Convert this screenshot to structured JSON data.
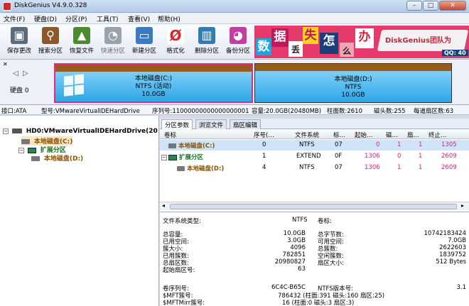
{
  "window": {
    "title": "DiskGenius V4.9.0.328",
    "min": "–",
    "max": "□",
    "close": "✕"
  },
  "menu": [
    "文件(F)",
    "硬盘(D)",
    "分区(P)",
    "工具(T)",
    "查看(V)",
    "帮助(H)"
  ],
  "toolbar": [
    {
      "label": "保存更改",
      "icon": "save-icon",
      "color": "#5d6b7e",
      "glyph": "▣"
    },
    {
      "label": "搜索分区",
      "icon": "search-icon",
      "color": "#8a5a2b",
      "glyph": "⚲"
    },
    {
      "label": "恢复文件",
      "icon": "recover-icon",
      "color": "#4d8a2f",
      "glyph": "▲"
    },
    {
      "label": "快速分区",
      "icon": "quick-partition-icon",
      "color": "#9aa3ad",
      "glyph": "◔"
    },
    {
      "label": "新建分区",
      "icon": "new-partition-icon",
      "color": "#3b7bbf",
      "glyph": "▭"
    },
    {
      "label": "格式化",
      "icon": "format-icon",
      "color": "#d22a2a",
      "glyph": "Ø"
    },
    {
      "label": "删除分区",
      "icon": "delete-partition-icon",
      "color": "#2f7db3",
      "glyph": "▥"
    },
    {
      "label": "备份分区",
      "icon": "backup-partition-icon",
      "color": "#c03fa0",
      "glyph": "◕"
    }
  ],
  "banner": {
    "chars": [
      "数",
      "据",
      "丢",
      "失",
      "怎",
      "么",
      "办"
    ],
    "brand": "DiskGenius团队为",
    "qq": "QQ: 40"
  },
  "diskpanel": {
    "nav_left": "◁",
    "nav_right": "▷",
    "label": "硬盘 0",
    "partitions": [
      {
        "name": "本地磁盘(C:)",
        "fs": "NTFS (活动)",
        "size": "10.0GB"
      },
      {
        "name": "本地磁盘(D:)",
        "fs": "NTFS",
        "size": "10.0GB"
      }
    ]
  },
  "infobar": {
    "iface": "接口:ATA",
    "model": "型号:VMwareVirtualIDEHardDrive",
    "serial": "序列号:11000000000000000001",
    "capacity": "容量:20.0GB(20480MB)",
    "cylinders": "柱面数:2610",
    "heads": "磁头数:255",
    "sectors": "每道扇区数:63"
  },
  "tree": {
    "disk": "HD0:VMwareVirtualIDEHardDrive(20",
    "c": "本地磁盘(C:)",
    "ext": "扩展分区",
    "d": "本地磁盘(D:)"
  },
  "tabs": [
    "分区参数",
    "浏览文件",
    "扇区编辑"
  ],
  "ptable": {
    "headers": [
      "卷标",
      "序号(…",
      "文件系统",
      "标…",
      "起始…",
      "磁…",
      "扇…",
      "终止…"
    ],
    "rows": [
      {
        "label": "本地磁盘(C:)",
        "num": "0",
        "fs": "NTFS",
        "id": "07",
        "start": "0",
        "head": "1",
        "sec": "1",
        "end": "1305"
      },
      {
        "label": "扩展分区",
        "num": "1",
        "fs": "EXTEND",
        "id": "0F",
        "start": "1306",
        "head": "0",
        "sec": "1",
        "end": "2609"
      },
      {
        "label": "本地磁盘(D:)",
        "num": "4",
        "fs": "NTFS",
        "id": "07",
        "start": "1306",
        "head": "1",
        "sec": "1",
        "end": "2609"
      }
    ]
  },
  "details": {
    "fs_type_label": "文件系统类型:",
    "fs_type": "NTFS",
    "volume_label": "卷标:",
    "left": [
      {
        "k": "总容量:",
        "v": "10.0GB"
      },
      {
        "k": "已用空间:",
        "v": "3.0GB"
      },
      {
        "k": "簇大小:",
        "v": "4096"
      },
      {
        "k": "已用簇数:",
        "v": "782851"
      },
      {
        "k": "总扇区数:",
        "v": "20980827"
      },
      {
        "k": "起始扇区号:",
        "v": "63"
      }
    ],
    "right": [
      {
        "k": "总字节数:",
        "v": "10742183424"
      },
      {
        "k": "可用空间:",
        "v": "7.0GB"
      },
      {
        "k": "总簇数:",
        "v": "2622603"
      },
      {
        "k": "空闲簇数:",
        "v": "1839752"
      },
      {
        "k": "扇区大小:",
        "v": "512 Bytes"
      }
    ],
    "serial_label": "卷序列号:",
    "serial": "6C4C-B65C",
    "ntfs_ver_label": "NTFS版本号:",
    "ntfs_ver": "3.1",
    "mft_label": "$MFT簇号:",
    "mft": "786432 (柱面:391 磁头:160 扇区:25)",
    "mftmirr_label": "$MFTMirr簇号:",
    "mftmirr": "16 (柱面:0 磁头:3 扇区:3)"
  }
}
